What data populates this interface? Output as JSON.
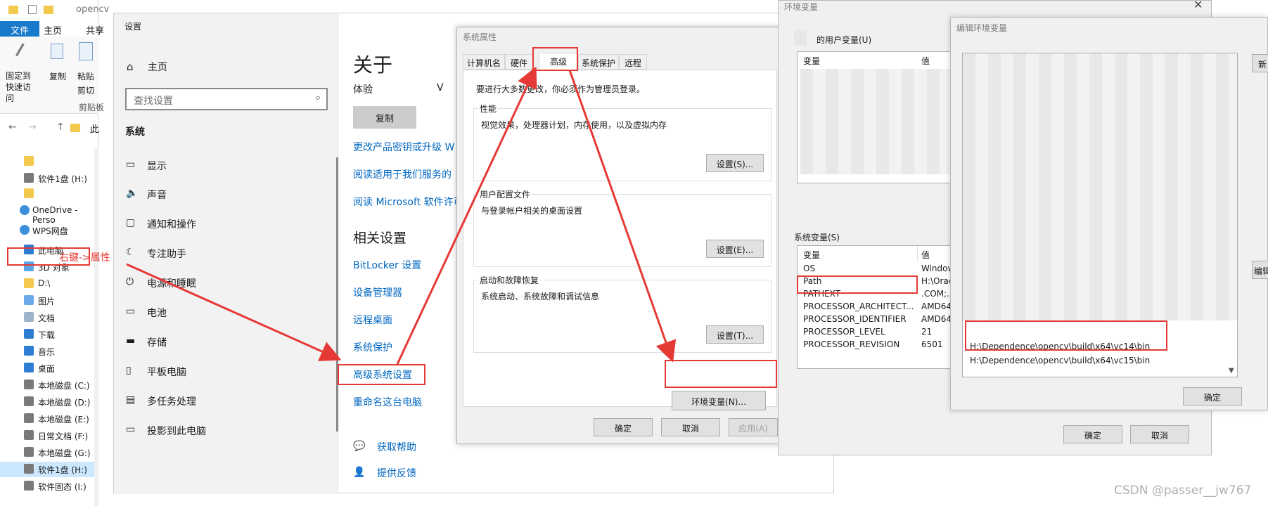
{
  "explorer": {
    "title": "opencv",
    "ribbon_tabs": [
      "文件",
      "主页",
      "共享"
    ],
    "ribbon_buttons": [
      "固定到快速访问",
      "复制",
      "粘贴",
      "剪切"
    ],
    "ribbon_group": "剪贴板",
    "address_crumb": "此",
    "nav_items": [
      {
        "label": "",
        "icon": "folder-icon"
      },
      {
        "label": "软件1盘 (H:)",
        "icon": "drive-icon"
      },
      {
        "label": "",
        "icon": "folder-icon"
      },
      {
        "label": "OneDrive - Perso",
        "icon": "cloud-icon"
      },
      {
        "label": "WPS网盘",
        "icon": "cloud-icon"
      },
      {
        "label": "此电脑",
        "icon": "computer-icon"
      },
      {
        "label": "3D 对象",
        "icon": "cube-icon"
      },
      {
        "label": "D:\\",
        "icon": "folder-icon"
      },
      {
        "label": "图片",
        "icon": "picture-icon"
      },
      {
        "label": "文档",
        "icon": "document-icon"
      },
      {
        "label": "下载",
        "icon": "download-icon"
      },
      {
        "label": "音乐",
        "icon": "music-icon"
      },
      {
        "label": "桌面",
        "icon": "desktop-icon"
      },
      {
        "label": "本地磁盘 (C:)",
        "icon": "drive-icon"
      },
      {
        "label": "本地磁盘 (D:)",
        "icon": "drive-icon"
      },
      {
        "label": "本地磁盘 (E:)",
        "icon": "drive-icon"
      },
      {
        "label": "日常文档 (F:)",
        "icon": "drive-icon"
      },
      {
        "label": "本地磁盘 (G:)",
        "icon": "drive-icon"
      },
      {
        "label": "软件1盘 (H:)",
        "icon": "drive-icon"
      },
      {
        "label": "软件固态 (I:)",
        "icon": "drive-icon"
      }
    ],
    "annotation": "右键->属性"
  },
  "settings": {
    "title": "设置",
    "home": "主页",
    "search_placeholder": "查找设置",
    "section": "系统",
    "items": [
      "显示",
      "声音",
      "通知和操作",
      "专注助手",
      "电源和睡眠",
      "电池",
      "存储",
      "平板电脑",
      "多任务处理",
      "投影到此电脑"
    ],
    "about_title": "关于",
    "experience_label": "体验",
    "experience_value": "V",
    "copy_button": "复制",
    "links_top": [
      "更改产品密钥或升级 W",
      "阅读适用于我们服务的",
      "阅读 Microsoft 软件许可"
    ],
    "related_title": "相关设置",
    "related_links": [
      "BitLocker 设置",
      "设备管理器",
      "远程桌面",
      "系统保护",
      "高级系统设置",
      "重命名这台电脑"
    ],
    "help_links": [
      "获取帮助",
      "提供反馈"
    ]
  },
  "system_properties": {
    "title": "系统属性",
    "tabs": [
      "计算机名",
      "硬件",
      "高级",
      "系统保护",
      "远程"
    ],
    "admin_note": "要进行大多数更改，你必须作为管理员登录。",
    "perf_title": "性能",
    "perf_desc": "视觉效果，处理器计划，内存使用，以及虚拟内存",
    "perf_button": "设置(S)...",
    "profile_title": "用户配置文件",
    "profile_desc": "与登录帐户相关的桌面设置",
    "profile_button": "设置(E)...",
    "startup_title": "启动和故障恢复",
    "startup_desc": "系统启动、系统故障和调试信息",
    "startup_button": "设置(T)...",
    "env_button": "环境变量(N)...",
    "ok": "确定",
    "cancel": "取消",
    "apply": "应用(A)"
  },
  "env_vars": {
    "title": "环境变量",
    "user_group": "的用户变量(U)",
    "col_var": "变量",
    "col_val": "值",
    "system_group": "系统变量(S)",
    "system_rows": [
      {
        "name": "OS",
        "value": "Window"
      },
      {
        "name": "Path",
        "value": "H:\\Orac"
      },
      {
        "name": "PATHEXT",
        "value": ".COM;.E"
      },
      {
        "name": "PROCESSOR_ARCHITECT...",
        "value": "AMD64"
      },
      {
        "name": "PROCESSOR_IDENTIFIER",
        "value": "AMD64"
      },
      {
        "name": "PROCESSOR_LEVEL",
        "value": "21"
      },
      {
        "name": "PROCESSOR_REVISION",
        "value": "6501"
      }
    ],
    "ok": "确定",
    "cancel": "取消"
  },
  "edit_env": {
    "title": "编辑环境变量",
    "paths": [
      "H:\\Dependence\\opencv\\build\\x64\\vc14\\bin",
      "H:\\Dependence\\opencv\\build\\x64\\vc15\\bin"
    ],
    "side_buttons": [
      "新",
      "编辑"
    ],
    "ok": "确定"
  },
  "watermark": "CSDN @passer__jw767",
  "colors": {
    "annotation_red": "#e53935",
    "link_blue": "#0067c0",
    "selection_blue": "#cce8ff"
  }
}
